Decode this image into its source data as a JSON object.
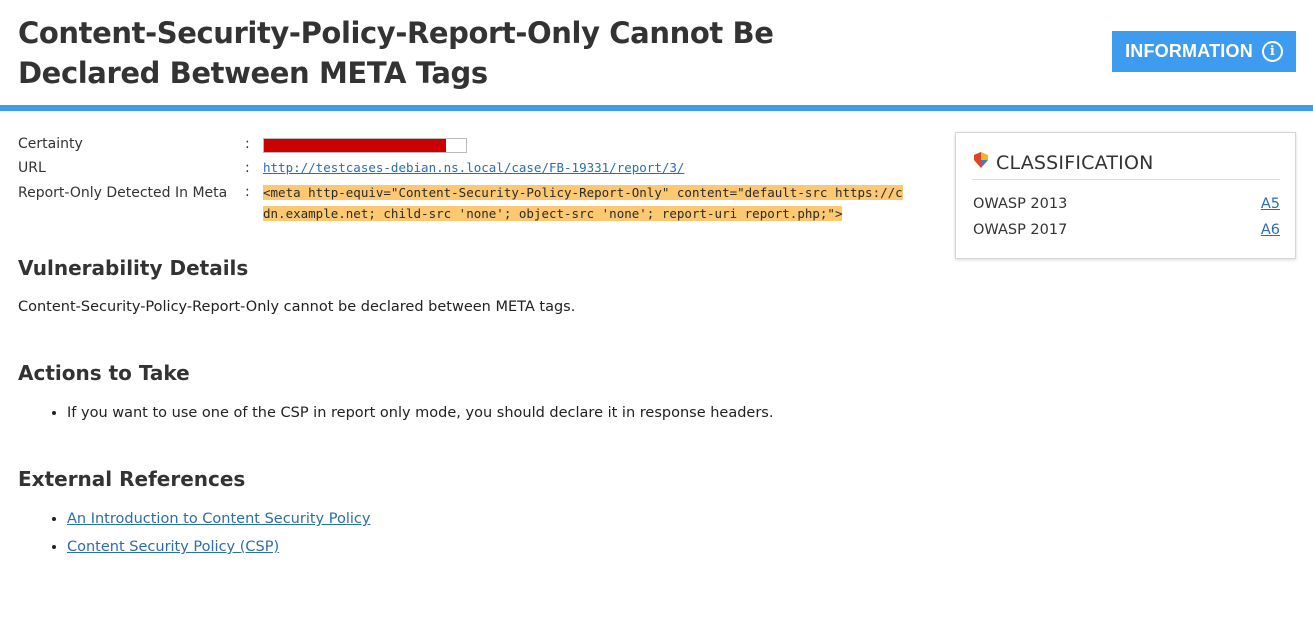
{
  "header": {
    "title": "Content-Security-Policy-Report-Only Cannot Be Declared Between META Tags",
    "severity_label": "INFORMATION",
    "severity_icon": "info-circle-icon",
    "accent_color": "#3d9bf0"
  },
  "properties": {
    "certainty": {
      "label": "Certainty",
      "value": 0.9,
      "bar_color": "#cc0000"
    },
    "url": {
      "label": "URL",
      "value": "http://testcases-debian.ns.local/case/FB-19331/report/3/"
    },
    "meta": {
      "label": "Report-Only Detected In Meta",
      "line1": "<meta http-equiv=\"Content-Security-Policy-Report-Only\" content=\"default-src https://c",
      "line2": "dn.example.net; child-src 'none'; object-src 'none'; report-uri report.php;\">",
      "highlight_color": "#fcc872"
    },
    "separator": ":"
  },
  "vulnerability_details": {
    "heading": "Vulnerability Details",
    "text": "Content-Security-Policy-Report-Only cannot be declared between META tags."
  },
  "actions": {
    "heading": "Actions to Take",
    "items": [
      "If you want to use one of the CSP in report only mode, you should declare it in response headers."
    ]
  },
  "references": {
    "heading": "External References",
    "items": [
      "An Introduction to Content Security Policy",
      "Content Security Policy (CSP)"
    ]
  },
  "classification": {
    "title": "CLASSIFICATION",
    "icon": "classification-badge-icon",
    "rows": [
      {
        "name": "OWASP 2013",
        "code": "A5"
      },
      {
        "name": "OWASP 2017",
        "code": "A6"
      }
    ]
  }
}
